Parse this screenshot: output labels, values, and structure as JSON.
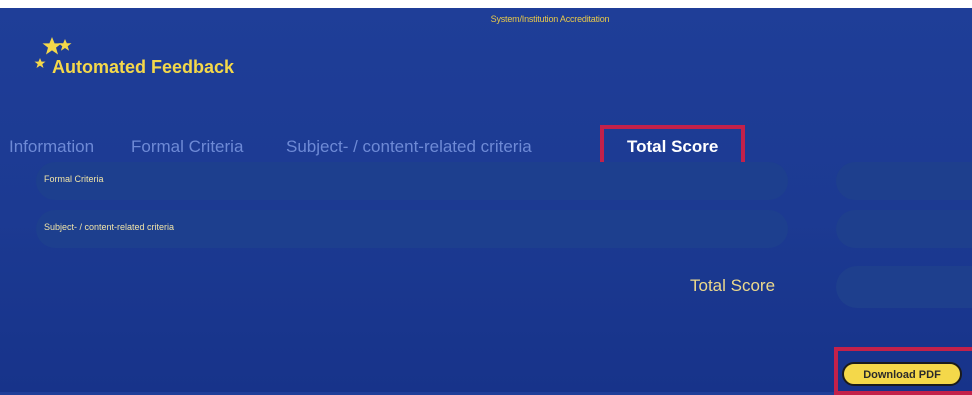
{
  "page": {
    "subtitle": "System/Institution Accreditation"
  },
  "header": {
    "logo_icon": "eu-stars-icon",
    "title": "Automated Feedback"
  },
  "tabs": [
    {
      "label": "Information",
      "active": false
    },
    {
      "label": "Formal Criteria",
      "active": false
    },
    {
      "label": "Subject- / content-related criteria",
      "active": false
    },
    {
      "label": "Total Score",
      "active": true
    }
  ],
  "criteria_rows": [
    {
      "label": "Formal Criteria",
      "score": ""
    },
    {
      "label": "Subject- / content-related criteria",
      "score": ""
    }
  ],
  "total": {
    "label": "Total Score",
    "score": ""
  },
  "actions": {
    "download_label": "Download PDF"
  },
  "colors": {
    "background": "#1c3a92",
    "accent_yellow": "#f4d84a",
    "highlight_red": "#c3214a",
    "active_tab_text": "#ffffff",
    "inactive_tab_text": "#6e8ad6"
  }
}
